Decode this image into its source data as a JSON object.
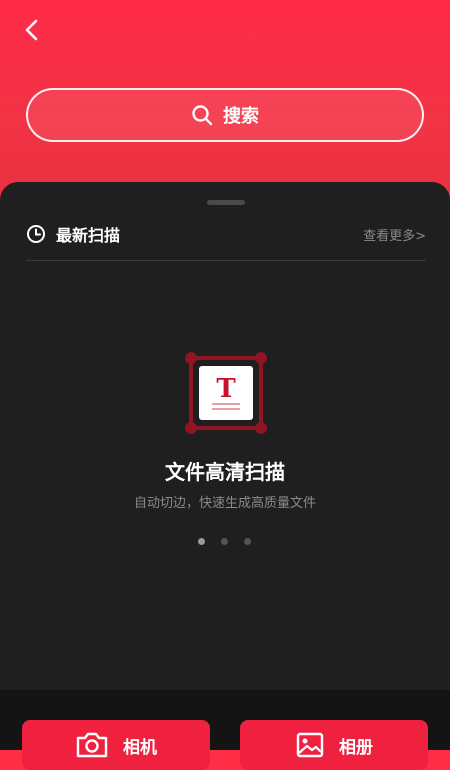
{
  "search": {
    "label": "搜索"
  },
  "recent": {
    "title": "最新扫描",
    "more": "查看更多>"
  },
  "feature": {
    "icon_letter": "T",
    "title": "文件高清扫描",
    "subtitle": "自动切边，快速生成高质量文件",
    "carousel": {
      "count": 3,
      "active_index": 0
    }
  },
  "actions": {
    "camera": "相机",
    "album": "相册"
  },
  "colors": {
    "brand": "#f0213f",
    "sheet": "#1f1f1f",
    "frame": "#8f1424"
  },
  "icons": {
    "back": "chevron-left-icon",
    "search": "search-icon",
    "recent": "clock-icon",
    "feature": "document-scan-icon",
    "camera": "camera-icon",
    "album": "image-icon"
  }
}
